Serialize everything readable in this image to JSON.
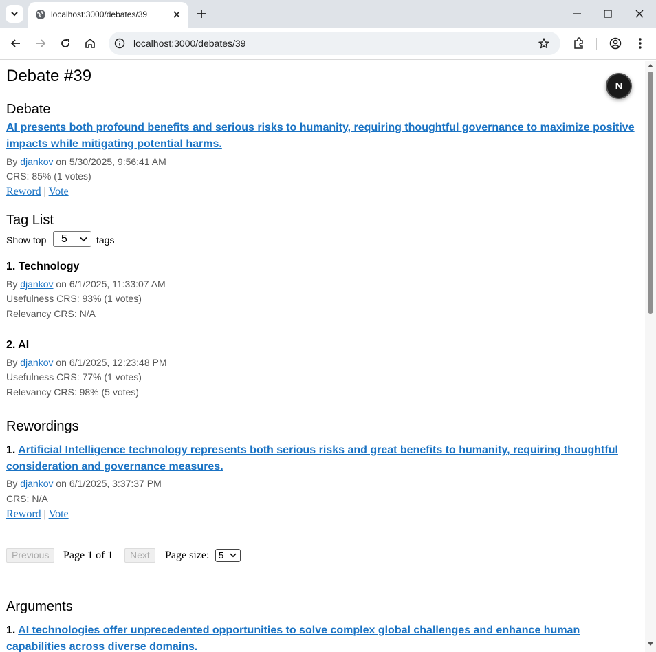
{
  "browser": {
    "tab_title": "localhost:3000/debates/39",
    "url": "localhost:3000/debates/39"
  },
  "page": {
    "heading": "Debate #39",
    "debate": {
      "section_title": "Debate",
      "title": "AI presents both profound benefits and serious risks to humanity, requiring thoughtful governance to maximize positive impacts while mitigating potential harms.",
      "by": "By",
      "author": "djankov",
      "date": "on 5/30/2025, 9:56:41 AM",
      "crs": "CRS: 85% (1 votes)",
      "reword": "Reword",
      "sep": "|",
      "vote": "Vote"
    },
    "tag_list": {
      "section_title": "Tag List",
      "show_top": "Show top",
      "show_top_value": "5",
      "tags_word": "tags",
      "items": [
        {
          "title": "1. Technology",
          "by": "By",
          "author": "djankov",
          "date": "on 6/1/2025, 11:33:07 AM",
          "usefulness": "Usefulness CRS: 93% (1 votes)",
          "relevancy": "Relevancy CRS: N/A"
        },
        {
          "title": "2. AI",
          "by": "By",
          "author": "djankov",
          "date": "on 6/1/2025, 12:23:48 PM",
          "usefulness": "Usefulness CRS: 77% (1 votes)",
          "relevancy": "Relevancy CRS: 98% (5 votes)"
        }
      ]
    },
    "rewordings": {
      "section_title": "Rewordings",
      "items": [
        {
          "num": "1.",
          "title": "Artificial Intelligence technology represents both serious risks and great benefits to humanity, requiring thoughtful consideration and governance measures.",
          "by": "By",
          "author": "djankov",
          "date": "on 6/1/2025, 3:37:37 PM",
          "crs": "CRS: N/A",
          "reword": "Reword",
          "sep": "|",
          "vote": "Vote"
        }
      ]
    },
    "pager": {
      "previous": "Previous",
      "page_text": "Page 1 of 1",
      "next": "Next",
      "page_size_label": "Page size:",
      "page_size_value": "5"
    },
    "arguments": {
      "section_title": "Arguments",
      "items": [
        {
          "num": "1.",
          "title": "AI technologies offer unprecedented opportunities to solve complex global challenges and enhance human capabilities across diverse domains."
        }
      ]
    },
    "next_badge": "N"
  }
}
